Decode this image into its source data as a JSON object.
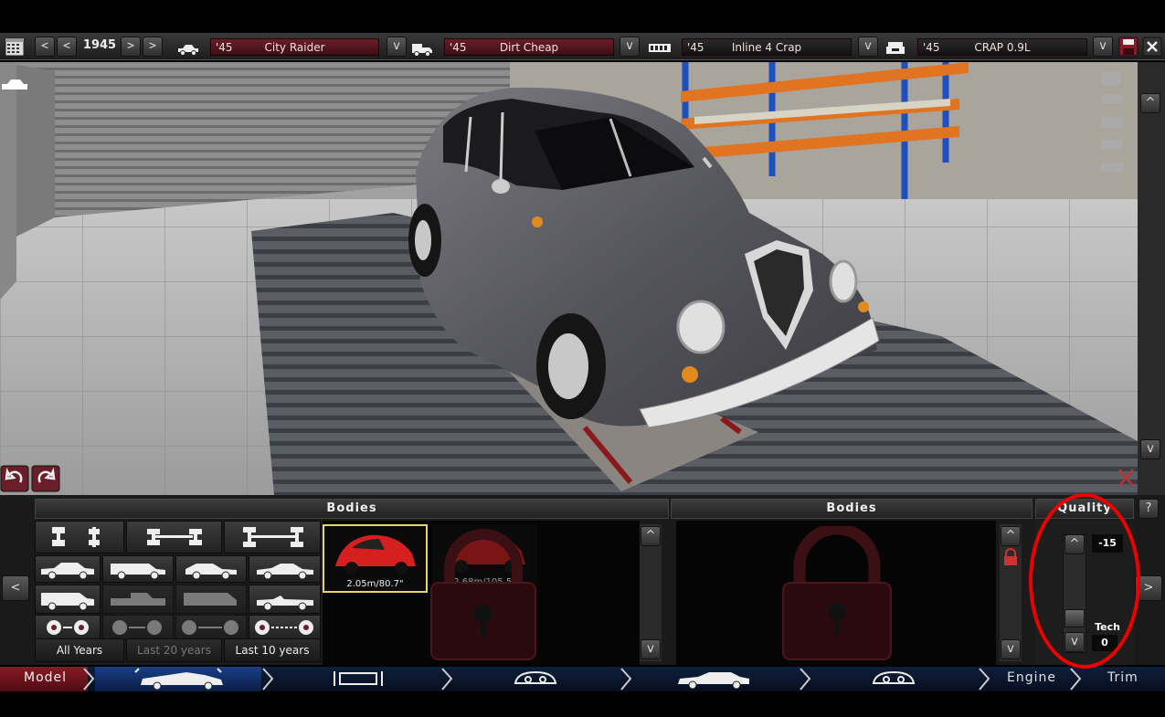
{
  "toolbar": {
    "year": "1945",
    "prev_label": "<",
    "next_label": ">",
    "model_selector": {
      "year": "'45",
      "name": "City Raider"
    },
    "trim_selector": {
      "year": "'45",
      "name": "Dirt Cheap"
    },
    "engine_selector": {
      "year": "'45",
      "name": "Inline 4 Crap"
    },
    "engine_variant_selector": {
      "year": "'45",
      "name": "CRAP 0.9L"
    },
    "dropdown_label": "v"
  },
  "left_panel": {
    "title": "Bodies",
    "year_filters": [
      "All Years",
      "Last 20 years",
      "Last 10 years"
    ],
    "bodies": [
      {
        "caption": "2.05m/80.7\"",
        "locked": false,
        "selected": true
      },
      {
        "caption": "2.68m/105.5\"",
        "locked": true,
        "selected": false
      }
    ]
  },
  "middle_panel": {
    "title": "Bodies"
  },
  "quality_panel": {
    "title": "Quality",
    "help_label": "?",
    "quality_value": "-15",
    "tech_label": "Tech",
    "tech_value": "0"
  },
  "scroll": {
    "up": "^",
    "down": "v"
  },
  "nav": {
    "model_label": "Model",
    "engine_label": "Engine",
    "trim_label": "Trim",
    "prev_label": "<",
    "next_label": ">"
  },
  "colors": {
    "accent": "#6a1e29",
    "annotation": "#e00000",
    "nav": "#0e1f3b"
  }
}
